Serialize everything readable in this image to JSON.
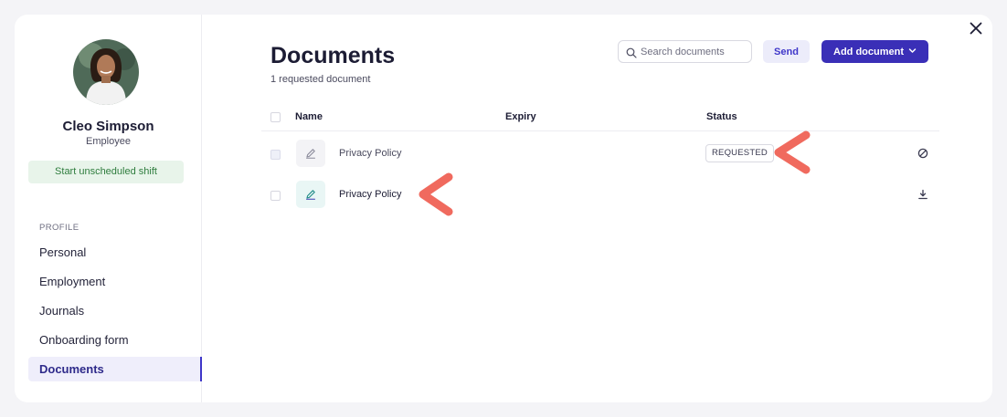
{
  "window": {
    "close_icon": "close-icon"
  },
  "profile": {
    "name": "Cleo Simpson",
    "role": "Employee",
    "shift_button": "Start unscheduled shift"
  },
  "sidebar": {
    "section_label": "PROFILE",
    "items": [
      {
        "label": "Personal",
        "active": false
      },
      {
        "label": "Employment",
        "active": false
      },
      {
        "label": "Journals",
        "active": false
      },
      {
        "label": "Onboarding form",
        "active": false
      },
      {
        "label": "Documents",
        "active": true
      }
    ]
  },
  "main": {
    "title": "Documents",
    "subtitle": "1 requested document",
    "search": {
      "placeholder": "Search documents",
      "value": ""
    },
    "send_label": "Send",
    "add_label": "Add document",
    "table": {
      "headers": {
        "name": "Name",
        "expiry": "Expiry",
        "status": "Status"
      },
      "rows": [
        {
          "name": "Privacy Policy",
          "expiry": "",
          "status": "REQUESTED",
          "action_icon": "cancel-icon"
        },
        {
          "name": "Privacy Policy",
          "expiry": "",
          "status": "",
          "action_icon": "download-icon"
        }
      ]
    }
  },
  "colors": {
    "accent": "#3a2fb7",
    "annotation": "#f06a5e",
    "shift_green": "#2f7d3e"
  }
}
